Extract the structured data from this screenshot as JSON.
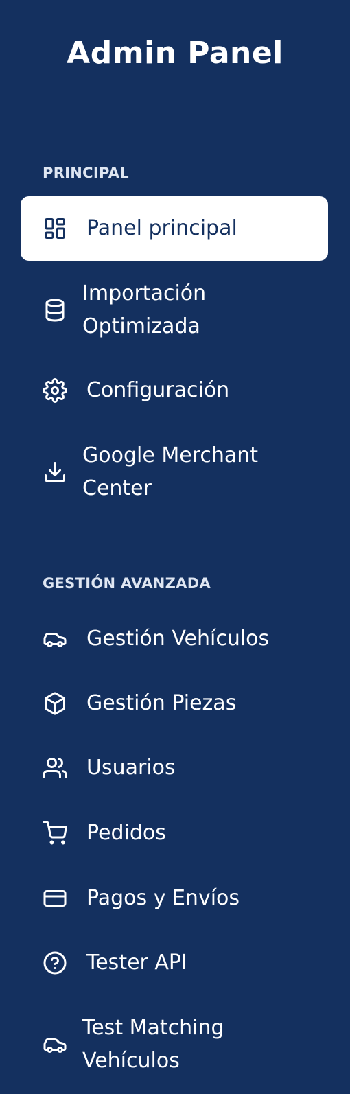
{
  "sidebar": {
    "title": "Admin Panel",
    "sections": [
      {
        "title": "PRINCIPAL"
      },
      {
        "title": "GESTIÓN AVANZADA"
      }
    ],
    "items": [
      {
        "label": "Panel principal",
        "icon": "dashboard-icon",
        "active": true
      },
      {
        "label": "Importación Optimizada",
        "icon": "database-icon",
        "active": false
      },
      {
        "label": "Configuración",
        "icon": "gear-icon",
        "active": false
      },
      {
        "label": "Google Merchant Center",
        "icon": "download-icon",
        "active": false
      },
      {
        "label": "Gestión Vehículos",
        "icon": "car-icon",
        "active": false
      },
      {
        "label": "Gestión Piezas",
        "icon": "package-icon",
        "active": false
      },
      {
        "label": "Usuarios",
        "icon": "users-icon",
        "active": false
      },
      {
        "label": "Pedidos",
        "icon": "cart-icon",
        "active": false
      },
      {
        "label": "Pagos y Envíos",
        "icon": "credit-card-icon",
        "active": false
      },
      {
        "label": "Tester API",
        "icon": "help-circle-icon",
        "active": false
      },
      {
        "label": "Test Matching Vehículos",
        "icon": "car-icon",
        "active": false
      }
    ]
  },
  "colors": {
    "background": "#14305f",
    "active_bg": "#ffffff",
    "active_text": "#14305f",
    "text": "#ffffff"
  }
}
